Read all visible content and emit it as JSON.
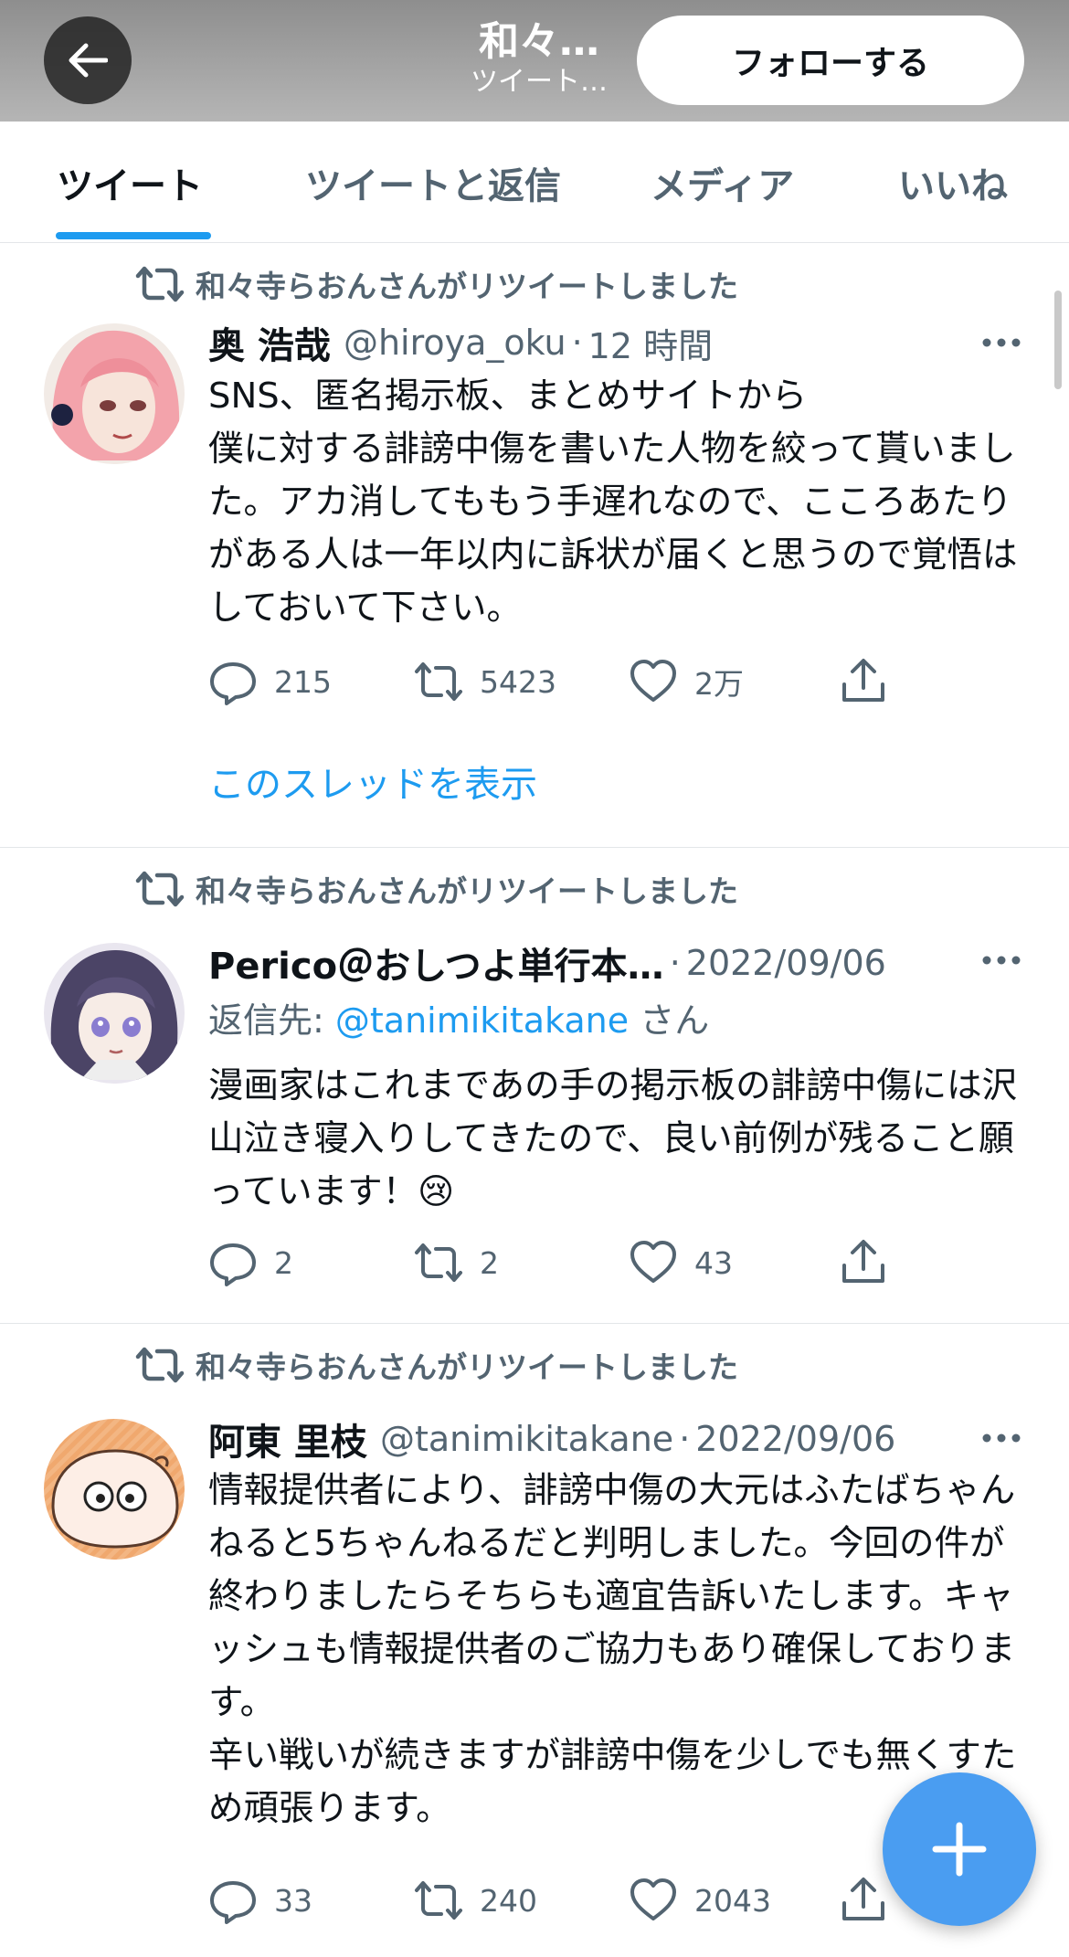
{
  "header": {
    "title": "和々…",
    "subtitle": "ツイート…",
    "follow_label": "フォローする"
  },
  "tabs": [
    {
      "label": "ツイート",
      "active": true
    },
    {
      "label": "ツイートと返信",
      "active": false
    },
    {
      "label": "メディア",
      "active": false
    },
    {
      "label": "いいね",
      "active": false
    }
  ],
  "tweets": [
    {
      "retweet_notice": "和々寺らおんさんがリツイートしました",
      "display_name": "奥 浩哉",
      "handle": "@hiroya_oku",
      "separator": "·",
      "time": "12 時間",
      "text": "SNS、匿名掲示板、まとめサイトから\n僕に対する誹謗中傷を書いた人物を絞って貰いました。アカ消してももう手遅れなので、こころあたりがある人は一年以内に訴状が届くと思うので覚悟はしておいて下さい。",
      "replies": "215",
      "retweets": "5423",
      "likes": "2万",
      "show_thread": "このスレッドを表示"
    },
    {
      "retweet_notice": "和々寺らおんさんがリツイートしました",
      "display_name": "Perico＠おしつよ単行本…",
      "separator": "·",
      "time": "2022/09/06",
      "reply_prefix": "返信先: ",
      "reply_mention": "@tanimikitakane",
      "reply_suffix": " さん",
      "text": "漫画家はこれまであの手の掲示板の誹謗中傷には沢山泣き寝入りしてきたので、良い前例が残ること願っています！😢",
      "replies": "2",
      "retweets": "2",
      "likes": "43"
    },
    {
      "retweet_notice": "和々寺らおんさんがリツイートしました",
      "display_name": "阿東 里枝",
      "handle": "@tanimikitakane",
      "separator": "·",
      "time": "2022/09/06",
      "text": "情報提供者により、誹謗中傷の大元はふたばちゃんねると5ちゃんねるだと判明しました。今回の件が終わりましたらそちらも適宜告訴いたします。キャッシュも情報提供者のご協力もあり確保しております。\n辛い戦いが続きますが誹謗中傷を少しでも無くすため頑張ります。",
      "replies": "33",
      "retweets": "240",
      "likes": "2043"
    }
  ],
  "icons": {
    "back": "arrow-left-icon",
    "retweet": "retweet-icon",
    "reply": "reply-icon",
    "like": "heart-icon",
    "share": "share-icon",
    "more": "more-icon",
    "compose": "plus-icon"
  },
  "colors": {
    "accent": "#1d9bf0",
    "fab": "#4a9df1",
    "secondary_text": "#536471",
    "primary_text": "#0f1419"
  }
}
